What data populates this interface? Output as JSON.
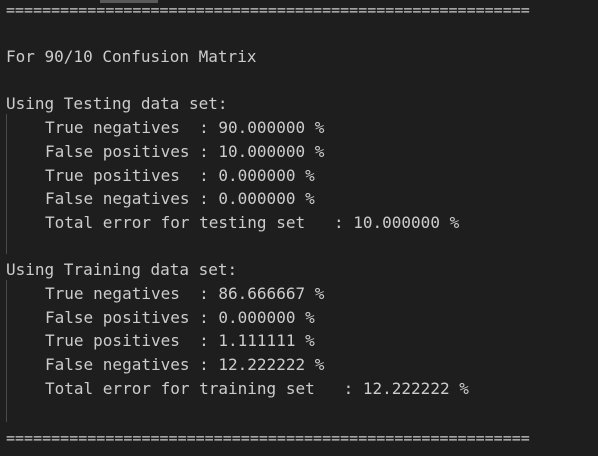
{
  "separator": "==========================================================",
  "heading": "For 90/10 Confusion Matrix",
  "testing": {
    "title": "Using Testing data set:",
    "lines": [
      "True negatives  : 90.000000 %",
      "False positives : 10.000000 %",
      "True positives  : 0.000000 %",
      "False negatives : 0.000000 %",
      "Total error for testing set   : 10.000000 %"
    ]
  },
  "training": {
    "title": "Using Training data set:",
    "lines": [
      "True negatives  : 86.666667 %",
      "False positives : 0.000000 %",
      "True positives  : 1.111111 %",
      "False negatives : 12.222222 %",
      "Total error for training set   : 12.222222 %"
    ]
  }
}
